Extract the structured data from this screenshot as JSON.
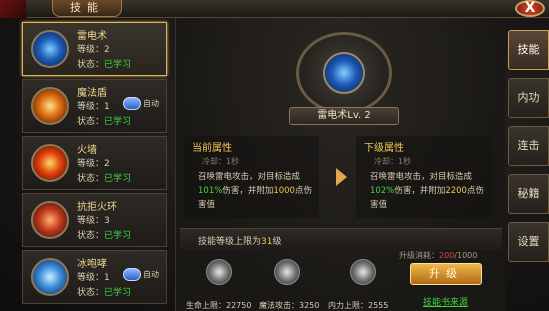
{
  "window": {
    "title": "技能",
    "close_label": "X"
  },
  "skills": [
    {
      "name": "雷电术",
      "level_label": "等级：",
      "level": "2",
      "status_label": "状态：",
      "status": "已学习",
      "auto": false
    },
    {
      "name": "魔法盾",
      "level_label": "等级：",
      "level": "1",
      "status_label": "状态：",
      "status": "已学习",
      "auto": true,
      "auto_label": "自动"
    },
    {
      "name": "火墙",
      "level_label": "等级：",
      "level": "2",
      "status_label": "状态：",
      "status": "已学习",
      "auto": false
    },
    {
      "name": "抗拒火环",
      "level_label": "等级：",
      "level": "3",
      "status_label": "状态：",
      "status": "已学习",
      "auto": false
    },
    {
      "name": "冰咆哮",
      "level_label": "等级：",
      "level": "1",
      "status_label": "状态：",
      "status": "已学习",
      "auto": true,
      "auto_label": "自动"
    }
  ],
  "detail": {
    "banner": "雷电术Lv. 2",
    "current": {
      "title": "当前属性",
      "cooldown": "冷却：1秒",
      "desc_1": "召唤雷电攻击，对目标造成",
      "pct": "101%",
      "desc_2": "伤害，并附加",
      "bonus": "1000",
      "desc_3": "点伤",
      "desc_4": "害值"
    },
    "next": {
      "title": "下级属性",
      "cooldown": "冷却：1秒",
      "desc_1": "召唤雷电攻击，对目标造成",
      "pct": "102%",
      "desc_2": "伤害，并附加",
      "bonus": "2200",
      "desc_3": "点伤",
      "desc_4": "害值"
    }
  },
  "limit": {
    "prefix": "技能等级上限为",
    "value": "31",
    "suffix": "级"
  },
  "cost": {
    "label": "升级消耗：",
    "current": "200",
    "total": "/1000"
  },
  "resources": [
    {
      "ball_text": "",
      "label": "生命上限：",
      "value": "22750"
    },
    {
      "ball_text": "",
      "label": "魔法攻击：",
      "value": "3250"
    },
    {
      "ball_text": "",
      "label": "内力上限：",
      "value": "2555"
    }
  ],
  "actions": {
    "upgrade": "升级",
    "source": "技能书来源"
  },
  "tabs": [
    {
      "label": "技能",
      "active": true
    },
    {
      "label": "内功",
      "active": false
    },
    {
      "label": "连击",
      "active": false
    },
    {
      "label": "秘籍",
      "active": false
    },
    {
      "label": "设置",
      "active": false
    }
  ]
}
